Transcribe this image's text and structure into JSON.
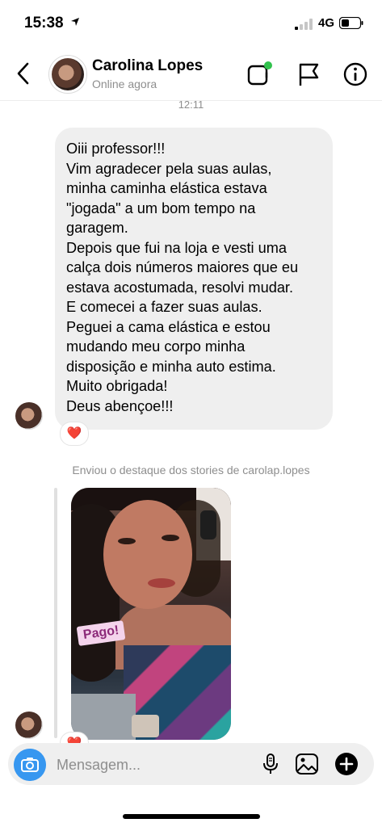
{
  "status_bar": {
    "time": "15:38",
    "network": "4G"
  },
  "header": {
    "name": "Carolina Lopes",
    "status": "Online agora"
  },
  "icons": {
    "back": "chevron-left-icon",
    "video_call": "video-call-icon",
    "report": "flag-icon",
    "info": "info-icon",
    "camera": "camera-icon",
    "mic": "microphone-icon",
    "gallery": "gallery-icon",
    "add": "plus-circle-icon"
  },
  "conversation": {
    "timestamp": "12:11",
    "message_lines": [
      "Oiii professor!!!",
      "Vim agradecer pela suas aulas,",
      "minha caminha elástica estava",
      "\"jogada\" a um bom tempo na",
      "garagem.",
      "Depois que fui na loja e vesti uma",
      "calça dois números maiores que eu",
      "estava acostumada, resolvi mudar.",
      "E comecei a fazer suas aulas.",
      "Peguei a cama elástica e estou",
      "mudando meu corpo minha",
      "disposição e minha auto estima.",
      "Muito obrigada!",
      "Deus abençoe!!!"
    ],
    "reaction": "❤️",
    "story_caption": "Enviou o destaque dos stories de carolap.lopes",
    "story_sticker": "Pago!",
    "story_reaction": "❤️"
  },
  "composer": {
    "placeholder": "Mensagem..."
  },
  "colors": {
    "accent": "#3797f0",
    "online": "#31c24d",
    "bubble": "#efefef"
  }
}
